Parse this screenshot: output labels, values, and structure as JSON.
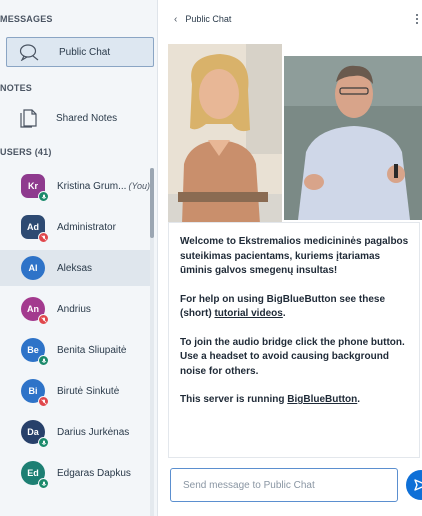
{
  "sidebar": {
    "messages_title": "MESSAGES",
    "public_chat_label": "Public Chat",
    "notes_title": "NOTES",
    "shared_notes_label": "Shared Notes",
    "users_title": "USERS (41)",
    "users": [
      {
        "initials": "Kr",
        "name": "Kristina Grum...",
        "you": "(You)",
        "color": "#8e3a8e",
        "status": "listen",
        "shape": "square"
      },
      {
        "initials": "Ad",
        "name": "Administrator",
        "you": "",
        "color": "#2d4a72",
        "status": "muted",
        "shape": "square"
      },
      {
        "initials": "Al",
        "name": "Aleksas",
        "you": "",
        "color": "#2e73c8",
        "status": "none",
        "shape": "round"
      },
      {
        "initials": "An",
        "name": "Andrius",
        "you": "",
        "color": "#a33a8e",
        "status": "muted",
        "shape": "round"
      },
      {
        "initials": "Be",
        "name": "Benita Šliupaitė",
        "you": "",
        "color": "#2e73c8",
        "status": "listen",
        "shape": "round"
      },
      {
        "initials": "Bi",
        "name": "Birutė Sinkutė",
        "you": "",
        "color": "#2e73c8",
        "status": "muted",
        "shape": "round"
      },
      {
        "initials": "Da",
        "name": "Darius Jurkėnas",
        "you": "",
        "color": "#27406a",
        "status": "listen",
        "shape": "round"
      },
      {
        "initials": "Ed",
        "name": "Edgaras Dapkus",
        "you": "",
        "color": "#1d7f73",
        "status": "listen",
        "shape": "round"
      }
    ]
  },
  "chat": {
    "back_glyph": "‹",
    "title": "Public Chat",
    "welcome": "Welcome to Ekstremalios medicininės pagalbos suteikimas pacientams, kuriems įtariamas ūminis galvos smegenų insultas!",
    "help_prefix": "For help on using BigBlueButton see these (short) ",
    "help_link": "tutorial videos",
    "help_suffix": ".",
    "audio_text": "To join the audio bridge click the phone button. Use a headset to avoid causing background noise for others.",
    "server_prefix": "This server is running ",
    "server_link": "BigBlueButton",
    "server_suffix": ".",
    "input_placeholder": "Send message to Public Chat"
  },
  "colors": {
    "accent": "#0f70d7",
    "muted": "#e0474c",
    "listen": "#1b8a6b"
  }
}
